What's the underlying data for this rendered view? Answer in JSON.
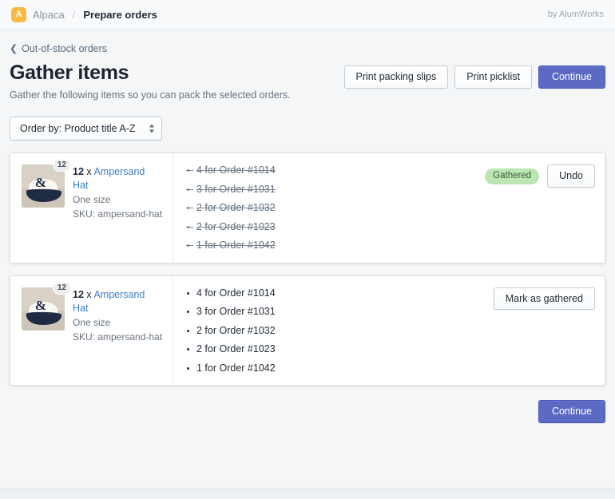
{
  "topbar": {
    "logo_letter": "A",
    "brand": "Alpaca",
    "separator": "/",
    "current": "Prepare orders",
    "byline": "by AlumWorks"
  },
  "header": {
    "back_label": "Out-of-stock orders",
    "back_icon": "chevron-left-icon",
    "title": "Gather items",
    "subtitle": "Gather the following items so you can pack the selected orders.",
    "actions": {
      "print_packing_slips": "Print packing slips",
      "print_picklist": "Print picklist",
      "continue": "Continue"
    }
  },
  "sort": {
    "label": "Order by: Product title A-Z",
    "icon": "select-caret-icon"
  },
  "cards": [
    {
      "state": "gathered",
      "thumbnail_alt": "ampersand-hat-thumbnail",
      "count_badge": "12",
      "quantity": "12",
      "multiplier": "x",
      "product_title": "Ampersand Hat",
      "variant": "One size",
      "sku": "SKU: ampersand-hat",
      "orders": [
        "4 for Order #1014",
        "3 for Order #1031",
        "2 for Order #1032",
        "2 for Order #1023",
        "1 for Order #1042"
      ],
      "status_badge": "Gathered",
      "action_label": "Undo"
    },
    {
      "state": "pending",
      "thumbnail_alt": "ampersand-hat-thumbnail",
      "count_badge": "12",
      "quantity": "12",
      "multiplier": "x",
      "product_title": "Ampersand Hat",
      "variant": "One size",
      "sku": "SKU: ampersand-hat",
      "orders": [
        "4 for Order #1014",
        "3 for Order #1031",
        "2 for Order #1032",
        "2 for Order #1023",
        "1 for Order #1042"
      ],
      "status_badge": null,
      "action_label": "Mark as gathered"
    }
  ],
  "footer": {
    "continue": "Continue"
  },
  "colors": {
    "page_background": "#f4f6f8",
    "primary_action": "#5c6ac4",
    "link": "#3d7ecb",
    "brand_logo": "#fcb941",
    "badge_success_bg": "#bbe5b3",
    "badge_success_text": "#3f5c3a",
    "card_border": "#e3e6ea"
  }
}
